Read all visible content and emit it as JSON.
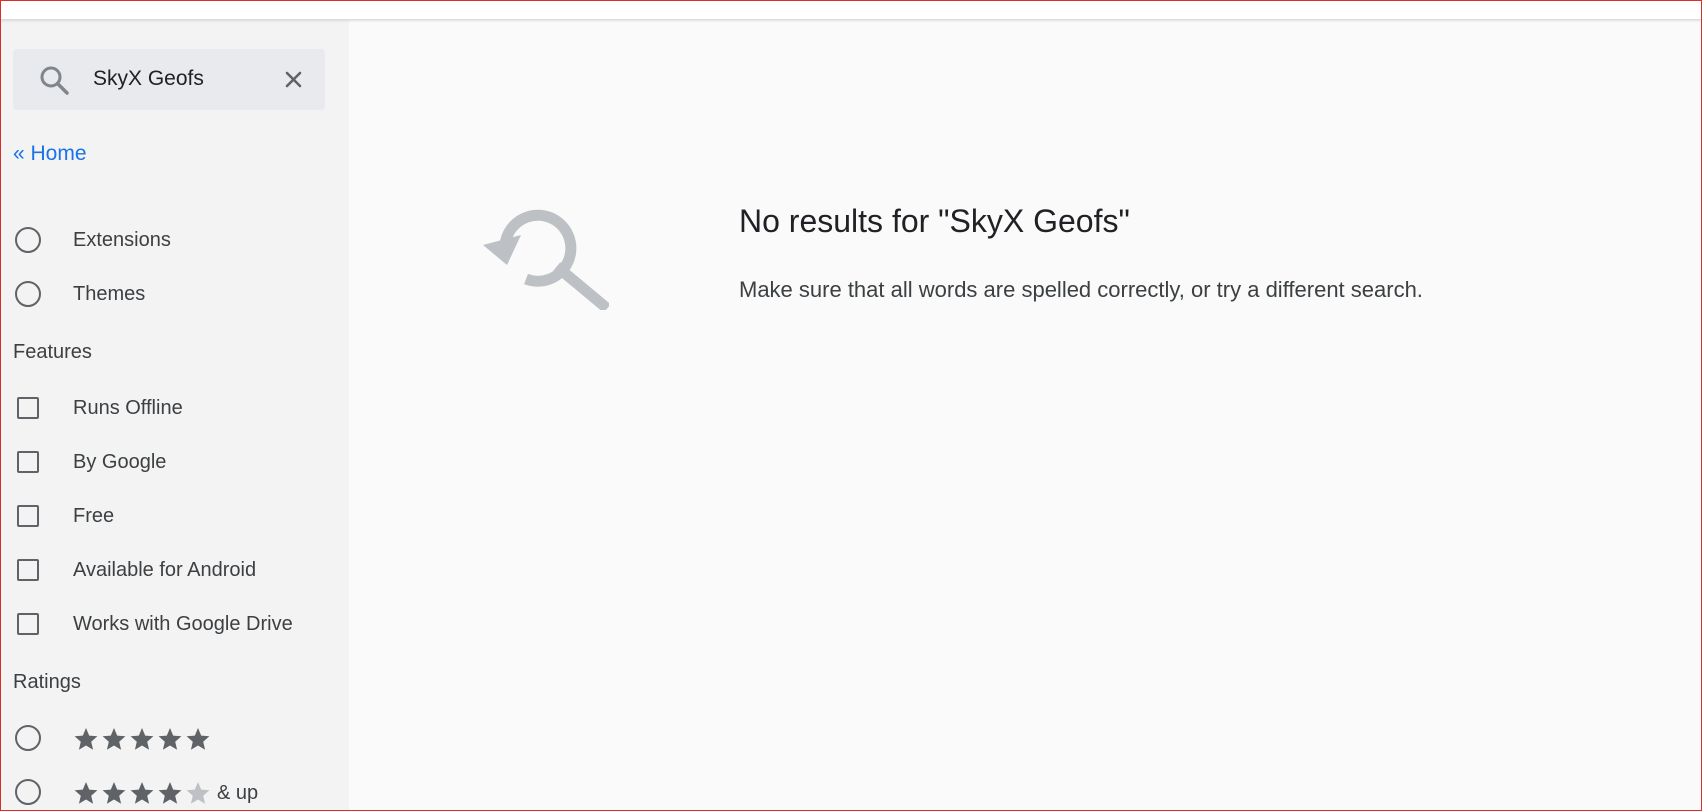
{
  "search": {
    "query": "SkyX Geofs",
    "icon": "search-icon",
    "clear_icon": "close-icon"
  },
  "nav": {
    "home_link": "« Home"
  },
  "type_filters": [
    {
      "label": "Extensions",
      "selected": false
    },
    {
      "label": "Themes",
      "selected": false
    }
  ],
  "features": {
    "title": "Features",
    "items": [
      {
        "label": "Runs Offline",
        "checked": false
      },
      {
        "label": "By Google",
        "checked": false
      },
      {
        "label": "Free",
        "checked": false
      },
      {
        "label": "Available for Android",
        "checked": false
      },
      {
        "label": "Works with Google Drive",
        "checked": false
      }
    ]
  },
  "ratings": {
    "title": "Ratings",
    "items": [
      {
        "stars": 5,
        "suffix": ""
      },
      {
        "stars": 4,
        "suffix": "& up"
      }
    ]
  },
  "results": {
    "title": "No results for \"SkyX Geofs\"",
    "message": "Make sure that all words are spelled correctly, or try a different search.",
    "icon": "search-refresh-icon"
  },
  "colors": {
    "link": "#1a73e8",
    "sidebar_bg": "#f3f3f3",
    "main_bg": "#fafafa",
    "star_filled": "#5f6368",
    "star_empty": "#bdc1c6",
    "frame": "#d93025"
  }
}
